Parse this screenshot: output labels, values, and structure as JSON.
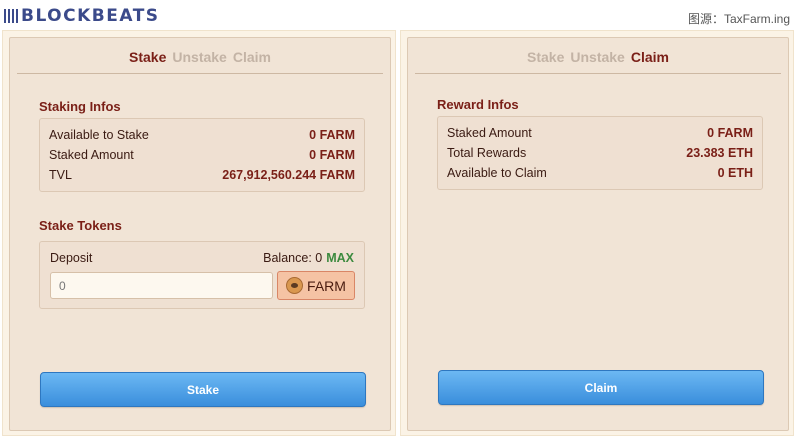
{
  "header": {
    "logo_text": "BLOCKBEATS",
    "source_label": "图源：TaxFarm.ing"
  },
  "left_panel": {
    "tabs": [
      {
        "label": "Stake",
        "active": true
      },
      {
        "label": "Unstake",
        "active": false
      },
      {
        "label": "Claim",
        "active": false
      }
    ],
    "staking_infos": {
      "title": "Staking Infos",
      "rows": [
        {
          "label": "Available to Stake",
          "value": "0 FARM"
        },
        {
          "label": "Staked Amount",
          "value": "0 FARM"
        },
        {
          "label": "TVL",
          "value": "267,912,560.244 FARM"
        }
      ]
    },
    "stake_tokens": {
      "title": "Stake Tokens",
      "deposit_label": "Deposit",
      "balance_label": "Balance: 0",
      "max_label": "MAX",
      "input_placeholder": "0",
      "token_label": "FARM"
    },
    "button_label": "Stake"
  },
  "right_panel": {
    "tabs": [
      {
        "label": "Stake",
        "active": false
      },
      {
        "label": "Unstake",
        "active": false
      },
      {
        "label": "Claim",
        "active": true
      }
    ],
    "reward_infos": {
      "title": "Reward Infos",
      "rows": [
        {
          "label": "Staked Amount",
          "value": "0 FARM"
        },
        {
          "label": "Total Rewards",
          "value": "23.383 ETH"
        },
        {
          "label": "Available to Claim",
          "value": "0 ETH"
        }
      ]
    },
    "button_label": "Claim"
  },
  "colors": {
    "accent": "#7a1f17",
    "tab_inactive": "#c3b3a5",
    "panel_bg": "#f1e4d6",
    "button_blue": "#3a8edc",
    "max_green": "#3c8a3e"
  }
}
